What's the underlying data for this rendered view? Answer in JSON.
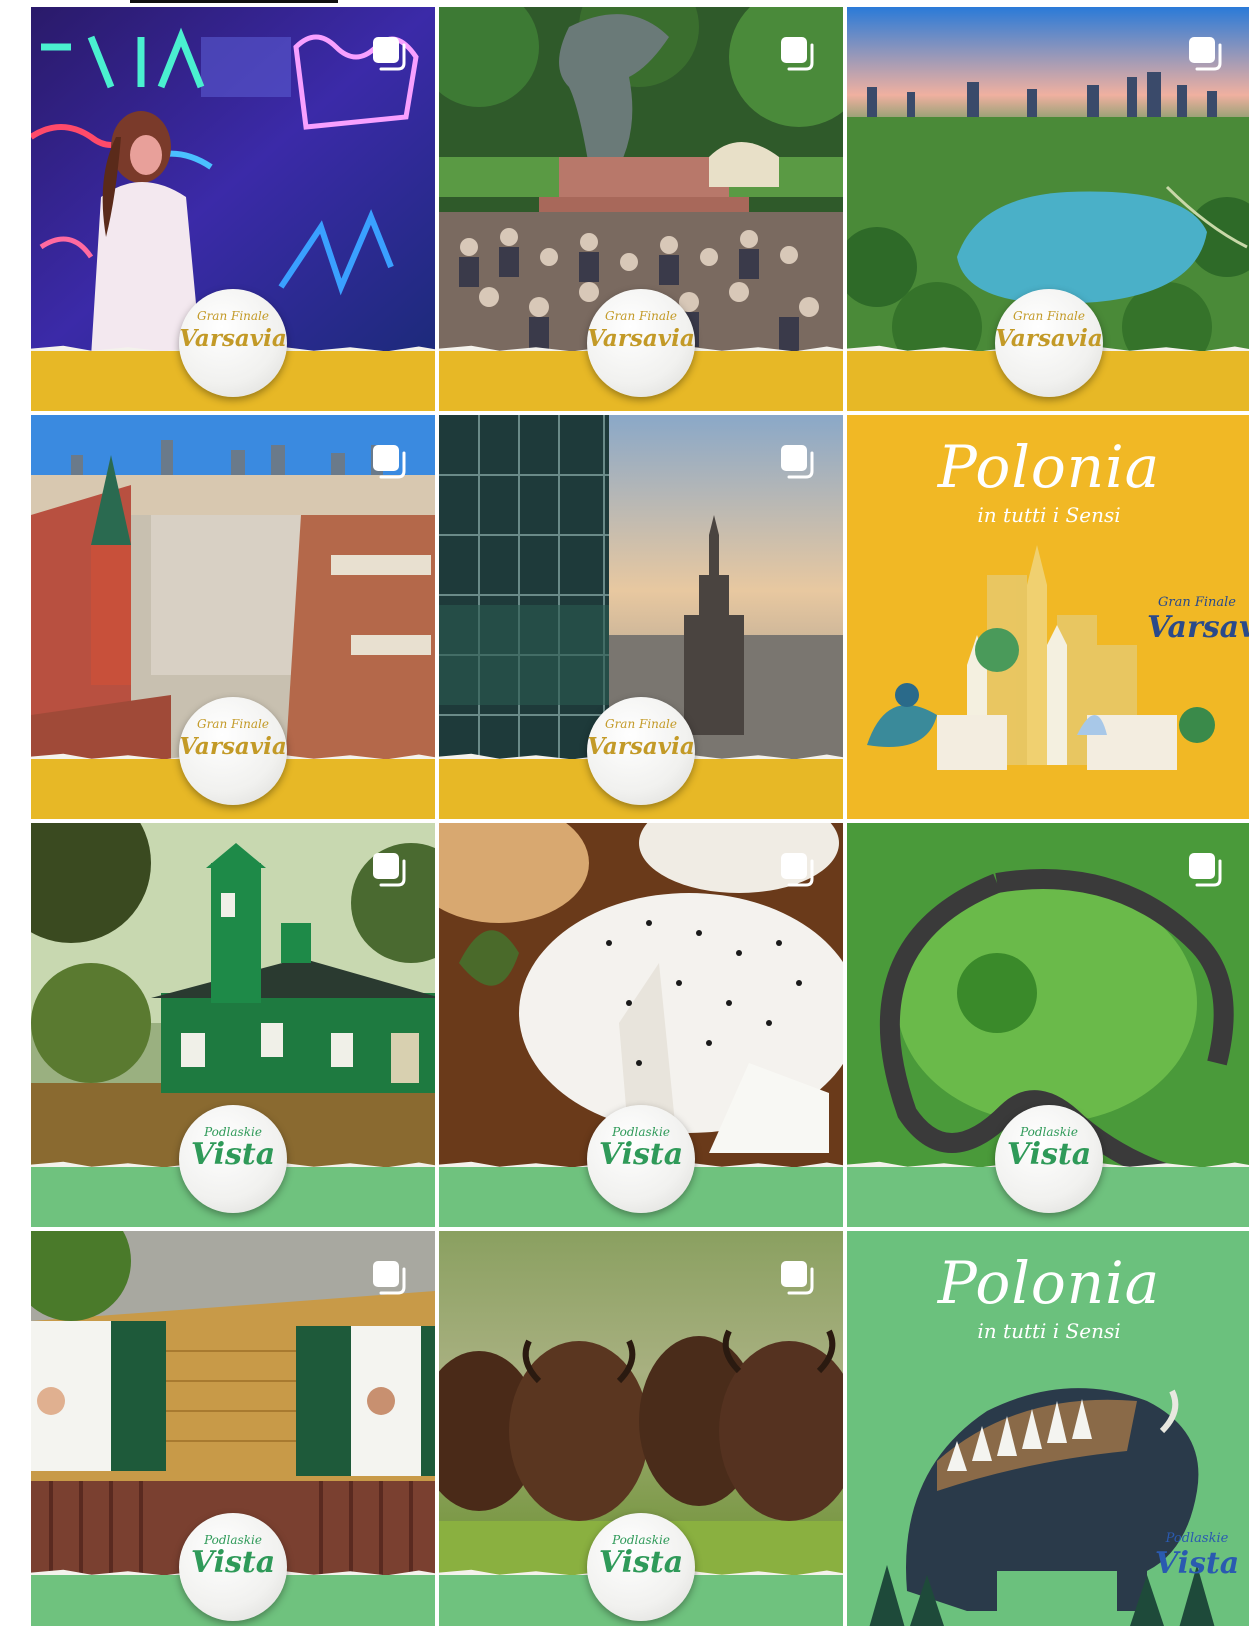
{
  "colors": {
    "varsavia_band": "#e7b826",
    "varsavia_text": "#c39a27",
    "vista_band": "#6fc27e",
    "vista_text": "#2f9a59",
    "poster_yellow": "#f1b825",
    "poster_green": "#6bc17d",
    "tab_indicator": "#111111"
  },
  "icons": {
    "multi": "carousel-stack-icon"
  },
  "posts": [
    {
      "scene": "neon-museum",
      "badge_top": "Gran Finale",
      "badge_main": "Varsavia",
      "theme": "varsavia"
    },
    {
      "scene": "chopin-monument",
      "badge_top": "Gran Finale",
      "badge_main": "Varsavia",
      "theme": "varsavia"
    },
    {
      "scene": "skyline-lake",
      "badge_top": "Gran Finale",
      "badge_main": "Varsavia",
      "theme": "varsavia"
    },
    {
      "scene": "old-town-square",
      "badge_top": "Gran Finale",
      "badge_main": "Varsavia",
      "theme": "varsavia"
    },
    {
      "scene": "palace-of-culture",
      "badge_top": "Gran Finale",
      "badge_main": "Varsavia",
      "theme": "varsavia"
    },
    {
      "scene": "poster-varsavia",
      "title": "Polonia",
      "subtitle": "in tutti i Sensi",
      "badge_top": "Gran Finale",
      "badge_main": "Varsavia",
      "theme": "varsavia"
    },
    {
      "scene": "wooden-mosque",
      "badge_top": "Podlaskie",
      "badge_main": "Vista",
      "theme": "vista"
    },
    {
      "scene": "cheese",
      "badge_top": "Podlaskie",
      "badge_main": "Vista",
      "theme": "vista"
    },
    {
      "scene": "river-bend",
      "badge_top": "Podlaskie",
      "badge_main": "Vista",
      "theme": "vista"
    },
    {
      "scene": "wooden-house",
      "badge_top": "Podlaskie",
      "badge_main": "Vista",
      "theme": "vista"
    },
    {
      "scene": "bison-herd",
      "badge_top": "Podlaskie",
      "badge_main": "Vista",
      "theme": "vista"
    },
    {
      "scene": "poster-vista",
      "title": "Polonia",
      "subtitle": "in tutti i Sensi",
      "badge_top": "Podlaskie",
      "badge_main": "Vista",
      "theme": "vista"
    }
  ]
}
